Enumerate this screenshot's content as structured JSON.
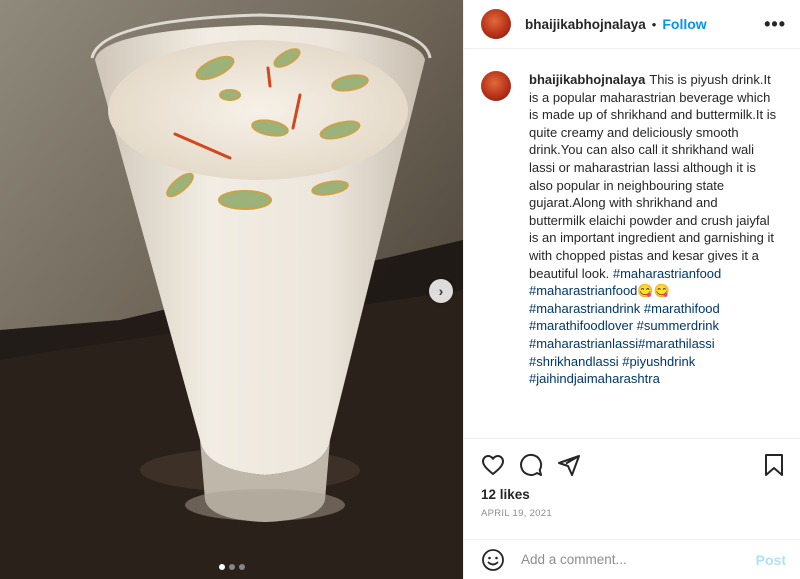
{
  "post": {
    "username": "bhaijikabhojnalaya",
    "separator": "•",
    "follow_label": "Follow",
    "more_label": "•••",
    "next_label": "›",
    "caption_username": "bhaijikabhojnalaya",
    "caption_body": "This is piyush drink.It is a popular maharastrian beverage which is made up of shrikhand and buttermilk.It is quite creamy and deliciously smooth drink.You can also call it shrikhand wali lassi or maharastrian lassi although it is also popular in neighbouring state gujarat.Along with shrikhand and buttermilk elaichi powder and crush jaiyfal is an important ingredient and garnishing it with chopped pistas and kesar gives it a beautiful look.",
    "hashtags": "#maharastrianfood #maharastrianfood😋😋 #maharastriandrink #marathifood #marathifoodlover #summerdrink #maharastrianlassi#marathilassi #shrikhandlassi #piyushdrink #jaihindjaimaharashtra",
    "likes": "12 likes",
    "date": "APRIL 19, 2021",
    "comment_placeholder": "Add a comment...",
    "post_label": "Post"
  },
  "carousel": {
    "count": 3,
    "active": 0
  },
  "icons": [
    "heart-icon",
    "comment-icon",
    "share-icon",
    "save-icon",
    "emoji-icon"
  ],
  "colors": {
    "accent": "#0095f6",
    "post_disabled": "#b2dffc",
    "text": "#262626",
    "muted": "#8e8e8e"
  }
}
